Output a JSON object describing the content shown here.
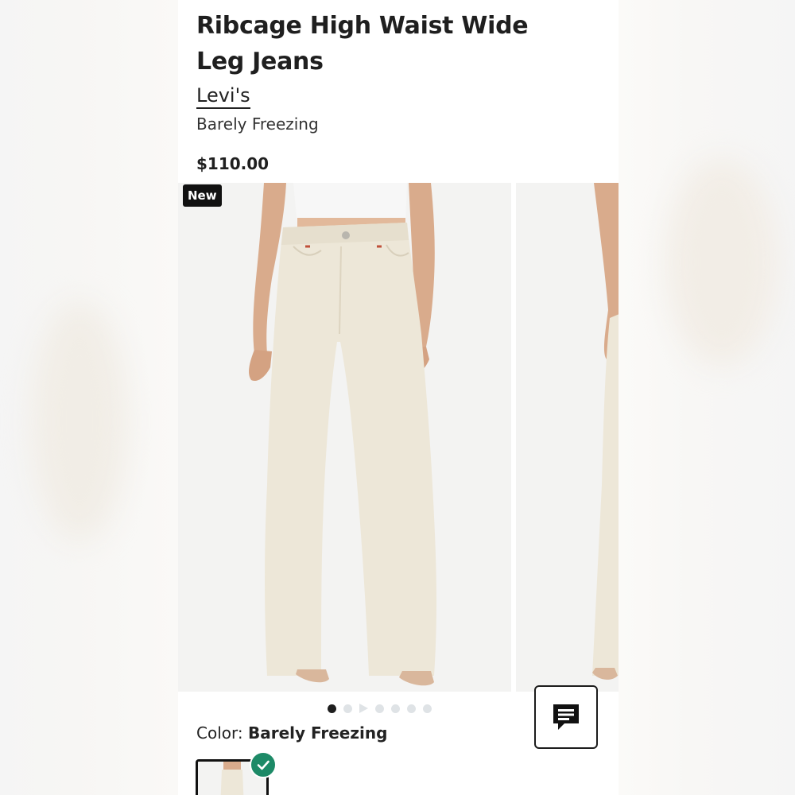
{
  "product": {
    "title": "Ribcage High Waist Wide Leg Jeans",
    "brand": "Levi's",
    "color_name": "Barely Freezing",
    "price": "$110.00",
    "badge": "New"
  },
  "gallery": {
    "slide_count": 7,
    "active_index": 0,
    "video_index": 2
  },
  "color_selector": {
    "label": "Color:",
    "selected": "Barely Freezing"
  },
  "icons": {
    "chat": "chat-icon",
    "selected_check": "check-icon",
    "video": "play-icon"
  },
  "colors": {
    "accent_green": "#1d8a67",
    "badge_bg": "#111111",
    "pants": "#ede7d8",
    "top": "#f7f7f7",
    "skin": "#d9ab8c"
  }
}
